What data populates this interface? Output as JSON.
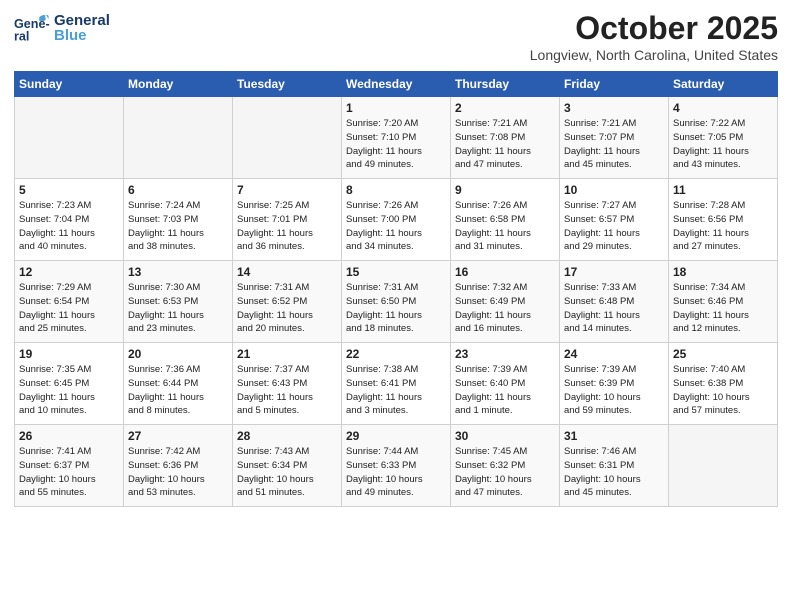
{
  "header": {
    "logo_general": "General",
    "logo_blue": "Blue",
    "month_title": "October 2025",
    "location": "Longview, North Carolina, United States"
  },
  "weekdays": [
    "Sunday",
    "Monday",
    "Tuesday",
    "Wednesday",
    "Thursday",
    "Friday",
    "Saturday"
  ],
  "weeks": [
    [
      {
        "day": "",
        "info": ""
      },
      {
        "day": "",
        "info": ""
      },
      {
        "day": "",
        "info": ""
      },
      {
        "day": "1",
        "info": "Sunrise: 7:20 AM\nSunset: 7:10 PM\nDaylight: 11 hours\nand 49 minutes."
      },
      {
        "day": "2",
        "info": "Sunrise: 7:21 AM\nSunset: 7:08 PM\nDaylight: 11 hours\nand 47 minutes."
      },
      {
        "day": "3",
        "info": "Sunrise: 7:21 AM\nSunset: 7:07 PM\nDaylight: 11 hours\nand 45 minutes."
      },
      {
        "day": "4",
        "info": "Sunrise: 7:22 AM\nSunset: 7:05 PM\nDaylight: 11 hours\nand 43 minutes."
      }
    ],
    [
      {
        "day": "5",
        "info": "Sunrise: 7:23 AM\nSunset: 7:04 PM\nDaylight: 11 hours\nand 40 minutes."
      },
      {
        "day": "6",
        "info": "Sunrise: 7:24 AM\nSunset: 7:03 PM\nDaylight: 11 hours\nand 38 minutes."
      },
      {
        "day": "7",
        "info": "Sunrise: 7:25 AM\nSunset: 7:01 PM\nDaylight: 11 hours\nand 36 minutes."
      },
      {
        "day": "8",
        "info": "Sunrise: 7:26 AM\nSunset: 7:00 PM\nDaylight: 11 hours\nand 34 minutes."
      },
      {
        "day": "9",
        "info": "Sunrise: 7:26 AM\nSunset: 6:58 PM\nDaylight: 11 hours\nand 31 minutes."
      },
      {
        "day": "10",
        "info": "Sunrise: 7:27 AM\nSunset: 6:57 PM\nDaylight: 11 hours\nand 29 minutes."
      },
      {
        "day": "11",
        "info": "Sunrise: 7:28 AM\nSunset: 6:56 PM\nDaylight: 11 hours\nand 27 minutes."
      }
    ],
    [
      {
        "day": "12",
        "info": "Sunrise: 7:29 AM\nSunset: 6:54 PM\nDaylight: 11 hours\nand 25 minutes."
      },
      {
        "day": "13",
        "info": "Sunrise: 7:30 AM\nSunset: 6:53 PM\nDaylight: 11 hours\nand 23 minutes."
      },
      {
        "day": "14",
        "info": "Sunrise: 7:31 AM\nSunset: 6:52 PM\nDaylight: 11 hours\nand 20 minutes."
      },
      {
        "day": "15",
        "info": "Sunrise: 7:31 AM\nSunset: 6:50 PM\nDaylight: 11 hours\nand 18 minutes."
      },
      {
        "day": "16",
        "info": "Sunrise: 7:32 AM\nSunset: 6:49 PM\nDaylight: 11 hours\nand 16 minutes."
      },
      {
        "day": "17",
        "info": "Sunrise: 7:33 AM\nSunset: 6:48 PM\nDaylight: 11 hours\nand 14 minutes."
      },
      {
        "day": "18",
        "info": "Sunrise: 7:34 AM\nSunset: 6:46 PM\nDaylight: 11 hours\nand 12 minutes."
      }
    ],
    [
      {
        "day": "19",
        "info": "Sunrise: 7:35 AM\nSunset: 6:45 PM\nDaylight: 11 hours\nand 10 minutes."
      },
      {
        "day": "20",
        "info": "Sunrise: 7:36 AM\nSunset: 6:44 PM\nDaylight: 11 hours\nand 8 minutes."
      },
      {
        "day": "21",
        "info": "Sunrise: 7:37 AM\nSunset: 6:43 PM\nDaylight: 11 hours\nand 5 minutes."
      },
      {
        "day": "22",
        "info": "Sunrise: 7:38 AM\nSunset: 6:41 PM\nDaylight: 11 hours\nand 3 minutes."
      },
      {
        "day": "23",
        "info": "Sunrise: 7:39 AM\nSunset: 6:40 PM\nDaylight: 11 hours\nand 1 minute."
      },
      {
        "day": "24",
        "info": "Sunrise: 7:39 AM\nSunset: 6:39 PM\nDaylight: 10 hours\nand 59 minutes."
      },
      {
        "day": "25",
        "info": "Sunrise: 7:40 AM\nSunset: 6:38 PM\nDaylight: 10 hours\nand 57 minutes."
      }
    ],
    [
      {
        "day": "26",
        "info": "Sunrise: 7:41 AM\nSunset: 6:37 PM\nDaylight: 10 hours\nand 55 minutes."
      },
      {
        "day": "27",
        "info": "Sunrise: 7:42 AM\nSunset: 6:36 PM\nDaylight: 10 hours\nand 53 minutes."
      },
      {
        "day": "28",
        "info": "Sunrise: 7:43 AM\nSunset: 6:34 PM\nDaylight: 10 hours\nand 51 minutes."
      },
      {
        "day": "29",
        "info": "Sunrise: 7:44 AM\nSunset: 6:33 PM\nDaylight: 10 hours\nand 49 minutes."
      },
      {
        "day": "30",
        "info": "Sunrise: 7:45 AM\nSunset: 6:32 PM\nDaylight: 10 hours\nand 47 minutes."
      },
      {
        "day": "31",
        "info": "Sunrise: 7:46 AM\nSunset: 6:31 PM\nDaylight: 10 hours\nand 45 minutes."
      },
      {
        "day": "",
        "info": ""
      }
    ]
  ]
}
